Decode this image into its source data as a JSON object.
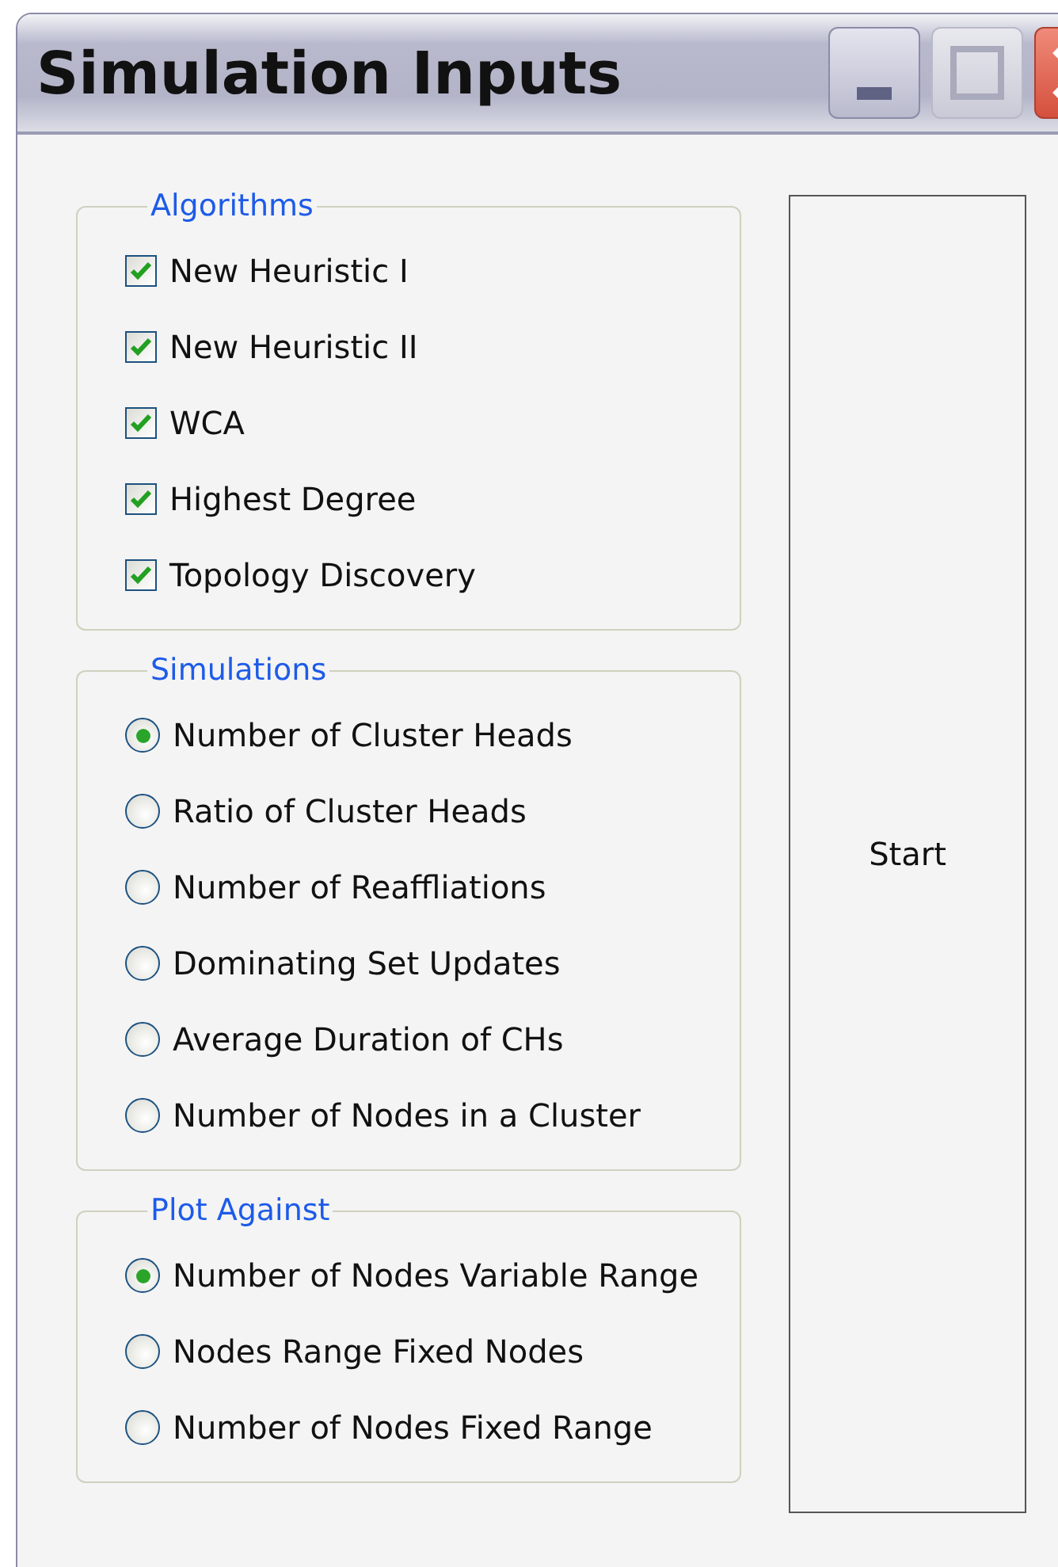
{
  "window": {
    "title": "Simulation Inputs"
  },
  "groups": [
    {
      "title": "Algorithms",
      "kind": "checkbox",
      "items": [
        {
          "label": "New Heuristic I",
          "checked": true
        },
        {
          "label": "New Heuristic II",
          "checked": true
        },
        {
          "label": "WCA",
          "checked": true
        },
        {
          "label": "Highest Degree",
          "checked": true
        },
        {
          "label": "Topology Discovery",
          "checked": true
        }
      ]
    },
    {
      "title": "Simulations",
      "kind": "radio",
      "items": [
        {
          "label": "Number of Cluster Heads",
          "selected": true
        },
        {
          "label": "Ratio of Cluster Heads",
          "selected": false
        },
        {
          "label": "Number of Reaffliations",
          "selected": false
        },
        {
          "label": "Dominating Set Updates",
          "selected": false
        },
        {
          "label": "Average Duration of CHs",
          "selected": false
        },
        {
          "label": "Number of Nodes in a Cluster",
          "selected": false
        }
      ]
    },
    {
      "title": "Plot Against",
      "kind": "radio",
      "items": [
        {
          "label": "Number of Nodes Variable Range",
          "selected": true
        },
        {
          "label": "Nodes Range Fixed Nodes",
          "selected": false
        },
        {
          "label": "Number of Nodes Fixed Range",
          "selected": false
        }
      ]
    }
  ],
  "start_button": {
    "label": "Start"
  }
}
